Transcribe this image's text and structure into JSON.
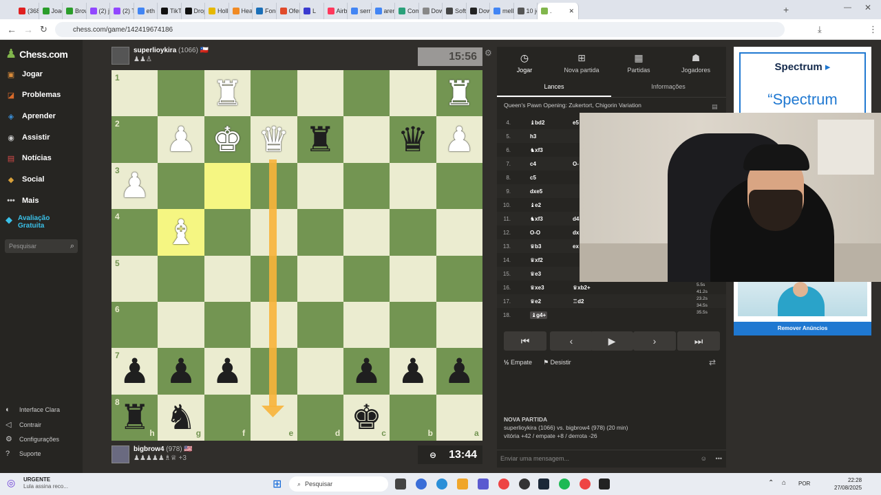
{
  "browser": {
    "tabs": [
      {
        "label": "(368",
        "color": "#e02020"
      },
      {
        "label": "Joao",
        "color": "#2a9d2a"
      },
      {
        "label": "Brow",
        "color": "#2a9d2a"
      },
      {
        "label": "(2) j",
        "color": "#9147ff"
      },
      {
        "label": "(2) Ti",
        "color": "#9147ff"
      },
      {
        "label": "eth",
        "color": "#4285f4"
      },
      {
        "label": "TikTo",
        "color": "#111"
      },
      {
        "label": "Drop",
        "color": "#111"
      },
      {
        "label": "Holl",
        "color": "#e6b800"
      },
      {
        "label": "Hea",
        "color": "#f08a24"
      },
      {
        "label": "Fond",
        "color": "#1a6fb8"
      },
      {
        "label": "Ofer",
        "color": "#e04a2a"
      },
      {
        "label": "L",
        "color": "#3a3acf"
      },
      {
        "label": "Airb",
        "color": "#ff385c"
      },
      {
        "label": "serri",
        "color": "#4285f4"
      },
      {
        "label": "aren",
        "color": "#4285f4"
      },
      {
        "label": "Com",
        "color": "#2aa07a"
      },
      {
        "label": "Dow",
        "color": "#888"
      },
      {
        "label": "Soft",
        "color": "#444"
      },
      {
        "label": "Dow",
        "color": "#222"
      },
      {
        "label": "mell",
        "color": "#4285f4"
      },
      {
        "label": "10 jo",
        "color": "#555"
      }
    ],
    "active_tab_label": ".",
    "url": "chess.com/game/142419674186"
  },
  "sidebar": {
    "logo": "Chess.com",
    "items": [
      {
        "label": "Jogar",
        "icon": "play-icon",
        "color": "#d88a3a"
      },
      {
        "label": "Problemas",
        "icon": "puzzle-icon",
        "color": "#d86a2a"
      },
      {
        "label": "Aprender",
        "icon": "learn-icon",
        "color": "#3a8fd8"
      },
      {
        "label": "Assistir",
        "icon": "binoculars-icon",
        "color": "#ccc"
      },
      {
        "label": "Notícias",
        "icon": "news-icon",
        "color": "#d84a4a"
      },
      {
        "label": "Social",
        "icon": "social-icon",
        "color": "#d8a03a"
      },
      {
        "label": "Mais",
        "icon": "more-icon",
        "color": "#ccc"
      }
    ],
    "promo": "Avaliação Gratuita",
    "search_placeholder": "Pesquisar",
    "footer": [
      "Interface Clara",
      "Contrair",
      "Configurações",
      "Suporte"
    ]
  },
  "game": {
    "top_player": {
      "name": "superlioykira",
      "rating": "(1066)"
    },
    "top_clock": "15:56",
    "bottom_player": {
      "name": "bigbrow4",
      "rating": "(978)",
      "material": "+3"
    },
    "bottom_clock": "13:44",
    "ranks": [
      "1",
      "2",
      "3",
      "4",
      "5",
      "6",
      "7",
      "8"
    ],
    "files": [
      "h",
      "g",
      "f",
      "e",
      "d",
      "c",
      "b",
      "a"
    ]
  },
  "panel": {
    "tabs": [
      {
        "label": "Jogar",
        "icon": "clock-icon"
      },
      {
        "label": "Nova partida",
        "icon": "plus-icon"
      },
      {
        "label": "Partidas",
        "icon": "board-icon"
      },
      {
        "label": "Jogadores",
        "icon": "players-icon"
      }
    ],
    "subtabs": [
      "Lances",
      "Informações"
    ],
    "opening": "Queen's Pawn Opening: Zukertort, Chigorin Variation",
    "moves": [
      {
        "n": "4.",
        "w": "♝bd2",
        "b": "e5"
      },
      {
        "n": "5.",
        "w": "h3",
        "b": ""
      },
      {
        "n": "6.",
        "w": "♞xf3",
        "b": ""
      },
      {
        "n": "7.",
        "w": "c4",
        "b": "O-"
      },
      {
        "n": "8.",
        "w": "c5",
        "b": ""
      },
      {
        "n": "9.",
        "w": "dxe5",
        "b": ""
      },
      {
        "n": "10.",
        "w": "♝e2",
        "b": ""
      },
      {
        "n": "11.",
        "w": "♞xf3",
        "b": "d4"
      },
      {
        "n": "12.",
        "w": "O-O",
        "b": "dx"
      },
      {
        "n": "13.",
        "w": "♛b3",
        "b": "ex"
      },
      {
        "n": "14.",
        "w": "♛xf2",
        "b": ""
      },
      {
        "n": "15.",
        "w": "♛e3",
        "b": ""
      },
      {
        "n": "16.",
        "w": "♛xe3",
        "b": "♛xb2+"
      },
      {
        "n": "17.",
        "w": "♛e2",
        "b": "♖d2"
      },
      {
        "n": "18.",
        "w": "♝g4+",
        "b": ""
      }
    ],
    "times": [
      "5.5s",
      "41.2s",
      "23.2s",
      "34.5s",
      "35.5s"
    ],
    "draw": "Empate",
    "resign": "Desistir",
    "new_game_title": "NOVA PARTIDA",
    "new_game_players": "superlioykira (1066) vs. bigbrow4 (978) (20 min)",
    "new_game_stats": "vitória +42 / empate +8 / derrota -26",
    "chat_placeholder": "Enviar uma mensagem..."
  },
  "ad": {
    "brand": "Spectrum",
    "quote": "“Spectrum",
    "remove": "Remover Anúncios"
  },
  "taskbar": {
    "notif_title": "URGENTE",
    "notif_text": "Lula assina reco...",
    "search": "Pesquisar",
    "lang": "POR",
    "time": "22:28",
    "date": "27/08/2025"
  }
}
